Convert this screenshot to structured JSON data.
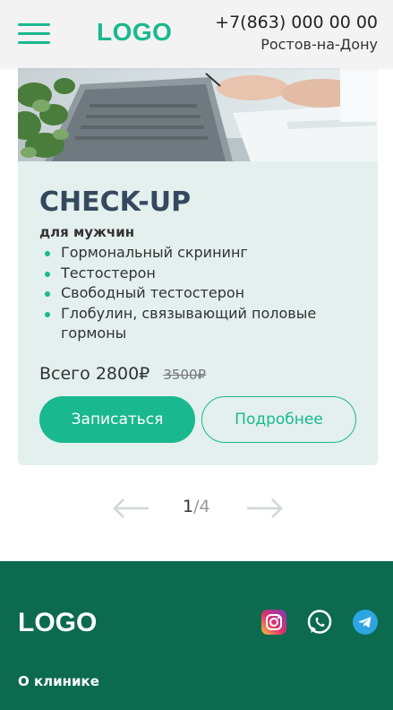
{
  "header": {
    "logo": "LOGO",
    "phone": "+7(863) 000 00 00",
    "city": "Ростов-на-Дону"
  },
  "card": {
    "title": "CHECK-UP",
    "subtitle": "для мужчин",
    "features": [
      "Гормональный скрининг",
      "Тестостерон",
      "Свободный тестостерон",
      "Глобулин, связывающий половые гормоны"
    ],
    "price": "Всего 2800₽",
    "old_price": "3500₽",
    "primary_button": "Записаться",
    "secondary_button": "Подробнее"
  },
  "pager": {
    "current": "1",
    "total": "/4"
  },
  "footer": {
    "logo": "LOGO",
    "about_link": "О клинике"
  },
  "colors": {
    "accent": "#1ab88f",
    "card_bg": "#e3f0ee",
    "footer_bg": "#0c6a4f",
    "header_bg": "#f3f3f3"
  }
}
